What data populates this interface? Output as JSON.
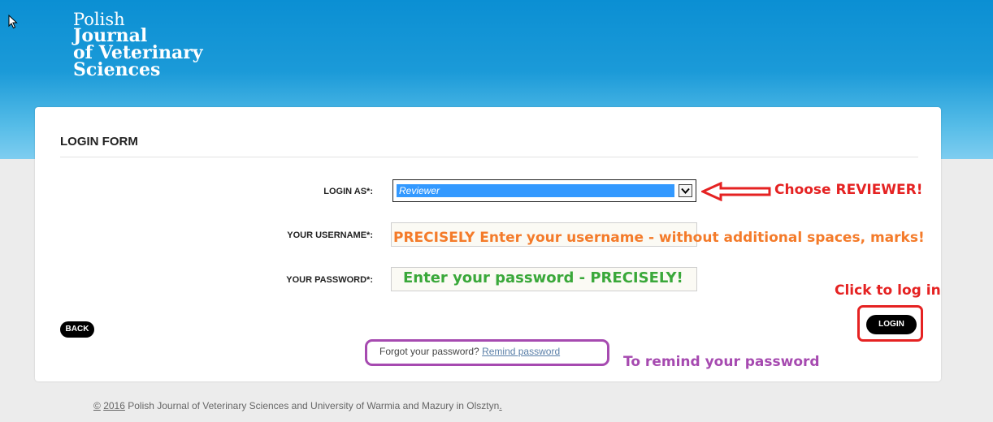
{
  "logo": {
    "line1": "Polish",
    "line2": "Journal",
    "line3": "of Veterinary",
    "line4": "Sciences"
  },
  "form": {
    "title": "LOGIN FORM",
    "login_as_label": "LOGIN AS*:",
    "login_as_value": "Reviewer",
    "username_label": "YOUR USERNAME*:",
    "password_label": "YOUR PASSWORD*:",
    "back_label": "BACK",
    "login_label": "LOGIN",
    "forgot_text": "Forgot your password?",
    "remind_link": "Remind password"
  },
  "annotations": {
    "choose_reviewer": "Choose REVIEWER!",
    "username_hint": "PRECISELY Enter your username - without additional spaces, marks!",
    "password_hint": "Enter your password - PRECISELY!",
    "click_login": "Click to log in",
    "remind_hint": "To remind your password"
  },
  "footer": {
    "copyright": "©",
    "year": "2016",
    "text": "Polish Journal of Veterinary Sciences and University of Warmia and Mazury in Olsztyn",
    "period": "."
  },
  "colors": {
    "banner": "#1b9ad8",
    "annotation_red": "#e52222",
    "annotation_orange": "#f47b2a",
    "annotation_green": "#3aa83a",
    "annotation_purple": "#a64ab0",
    "selection_blue": "#3399ff"
  }
}
